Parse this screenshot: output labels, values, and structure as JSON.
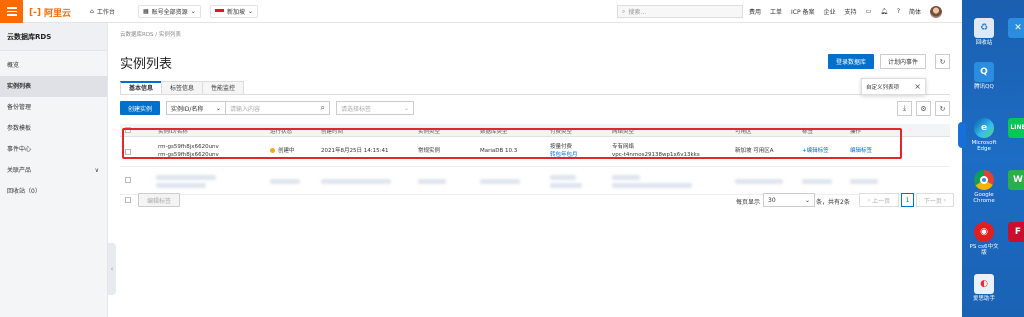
{
  "topbar": {
    "logo_text": "阿里云",
    "workbench": "工作台",
    "account_resources": "账号全部资源",
    "region": "新加坡",
    "search_placeholder": "搜索...",
    "links": [
      "费用",
      "工单",
      "ICP 备案",
      "企业",
      "支持"
    ],
    "lang": "简体"
  },
  "sidebar": {
    "title": "云数据库RDS",
    "items": [
      {
        "label": "概览",
        "active": false
      },
      {
        "label": "实例列表",
        "active": true
      },
      {
        "label": "备份管理",
        "active": false
      },
      {
        "label": "参数模板",
        "active": false
      },
      {
        "label": "事件中心",
        "active": false
      },
      {
        "label": "关联产品",
        "active": false,
        "suffix": "∨"
      },
      {
        "label": "回收站（0）",
        "active": false
      }
    ]
  },
  "main": {
    "breadcrumb": "云数据库RDS / 实例列表",
    "page_title": "实例列表",
    "login_db_button": "登录数据库",
    "planned_events_button": "计划内事件",
    "tabs": [
      "基本信息",
      "标签信息",
      "性能监控"
    ],
    "popover_text": "自定义列表项",
    "create_instance_button": "创建实例",
    "filter_select": "实例ID/名称",
    "search_placeholder": "请输入内容",
    "tag_select": "请选择标签",
    "columns": [
      "实例ID/名称",
      "运行状态",
      "创建时间",
      "实例类型",
      "数据库类型",
      "付费类型",
      "网络类型",
      "可用区",
      "标签",
      "操作"
    ],
    "row": {
      "id": "rm-gs59fh8jx6620unv",
      "name": "rm-gs59fh8jx6620unv",
      "status": "创建中",
      "created": "2021年8月25日 14:15:41",
      "instance_type": "常规实例",
      "db_type": "MariaDB 10.3",
      "pay_type": "按量付费",
      "pay_link": "转包年包月",
      "network_type": "专有网络",
      "vpc": "vpc-t4nmos29138wp1x6v13kks",
      "zone": "新加坡 可用区A",
      "tag_link": "+编辑标签",
      "action_link": "编辑标签"
    },
    "batch_tag_button": "编辑标签",
    "pager": {
      "per_page_label": "每页显示",
      "per_page_value": "30",
      "total_text": "条，共有2条",
      "prev": "上一页",
      "current": "1",
      "next": "下一页"
    }
  },
  "desktop": {
    "icons": [
      {
        "label": "回收站",
        "color": "#dfe9f3"
      },
      {
        "label": "腾讯QQ",
        "color": "#2a8de0"
      },
      {
        "label": "Microsoft Edge",
        "color": "#1c8fd8"
      },
      {
        "label": "Google Chrome",
        "color": "#ffffff"
      },
      {
        "label": "PS cs6中文版",
        "color": "#e02020"
      },
      {
        "label": "爱思助手",
        "color": "#e8f0f8"
      }
    ],
    "icons_right": [
      {
        "label": "VSCode",
        "color": "#2a8de0"
      },
      {
        "label": "LINE",
        "color": "#06c755"
      },
      {
        "label": "WPS",
        "color": "#2ab04a"
      },
      {
        "label": "FR",
        "color": "#c8102e"
      }
    ]
  }
}
